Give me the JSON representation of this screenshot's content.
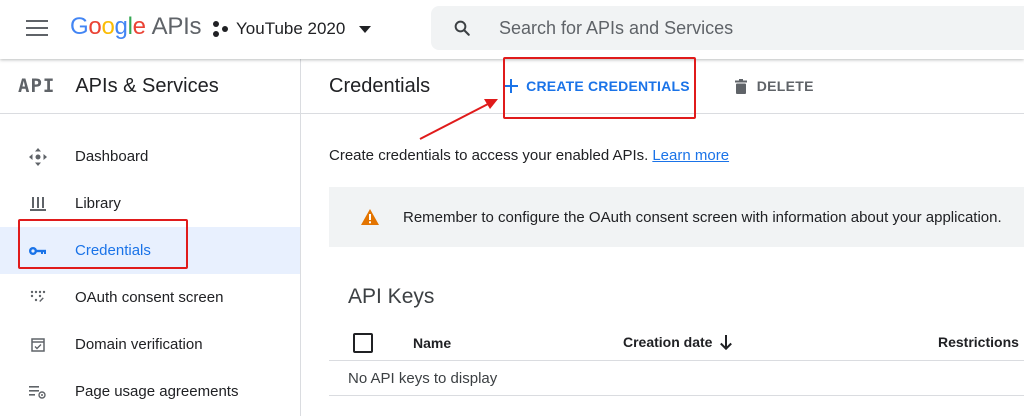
{
  "topbar": {
    "logo_google": [
      "G",
      "o",
      "o",
      "g",
      "l",
      "e"
    ],
    "logo_suffix": "APIs",
    "project_name": "YouTube 2020",
    "search_placeholder": "Search for APIs and Services"
  },
  "sidebar": {
    "badge": "API",
    "title": "APIs & Services",
    "items": [
      {
        "label": "Dashboard",
        "icon": "dashboard-icon"
      },
      {
        "label": "Library",
        "icon": "library-icon"
      },
      {
        "label": "Credentials",
        "icon": "key-icon",
        "active": true
      },
      {
        "label": "OAuth consent screen",
        "icon": "oauth-icon"
      },
      {
        "label": "Domain verification",
        "icon": "domain-verification-icon"
      },
      {
        "label": "Page usage agreements",
        "icon": "page-usage-icon"
      }
    ]
  },
  "main": {
    "title": "Credentials",
    "create_label": "CREATE CREDENTIALS",
    "delete_label": "DELETE",
    "intro_text": "Create credentials to access your enabled APIs.",
    "learn_more": "Learn more",
    "banner_text": "Remember to configure the OAuth consent screen with information about your application.",
    "api_keys": {
      "title": "API Keys",
      "columns": [
        "Name",
        "Creation date",
        "Restrictions"
      ],
      "empty_text": "No API keys to display"
    }
  },
  "colors": {
    "accent": "#1a73e8",
    "warning": "#e37400",
    "annotation": "#e01b1b"
  }
}
